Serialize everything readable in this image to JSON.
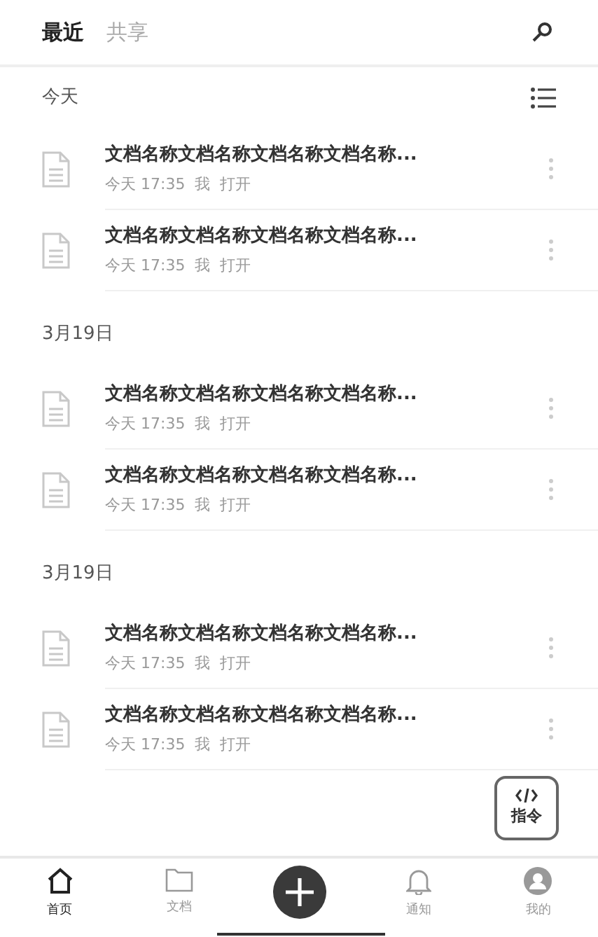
{
  "tabs": [
    {
      "label": "最近",
      "selected": true
    },
    {
      "label": "共享",
      "selected": false
    }
  ],
  "sections": [
    {
      "title": "今天",
      "items": [
        {
          "name": "文档名称文档名称文档名称文档名称...",
          "time": "今天 17:35",
          "user": "我",
          "action": "打开"
        },
        {
          "name": "文档名称文档名称文档名称文档名称...",
          "time": "今天 17:35",
          "user": "我",
          "action": "打开"
        }
      ]
    },
    {
      "title": "3月19日",
      "items": [
        {
          "name": "文档名称文档名称文档名称文档名称...",
          "time": "今天 17:35",
          "user": "我",
          "action": "打开"
        },
        {
          "name": "文档名称文档名称文档名称文档名称...",
          "time": "今天 17:35",
          "user": "我",
          "action": "打开"
        }
      ]
    },
    {
      "title": "3月19日",
      "items": [
        {
          "name": "文档名称文档名称文档名称文档名称...",
          "time": "今天 17:35",
          "user": "我",
          "action": "打开"
        },
        {
          "name": "文档名称文档名称文档名称文档名称...",
          "time": "今天 17:35",
          "user": "我",
          "action": "打开"
        }
      ]
    }
  ],
  "command_button": {
    "label": "指令"
  },
  "bottom_nav": [
    {
      "kind": "home",
      "label": "首页",
      "selected": true
    },
    {
      "kind": "folder",
      "label": "文档",
      "selected": false
    },
    {
      "kind": "add"
    },
    {
      "kind": "bell",
      "label": "通知",
      "selected": false
    },
    {
      "kind": "profile",
      "label": "我的",
      "selected": false
    }
  ]
}
